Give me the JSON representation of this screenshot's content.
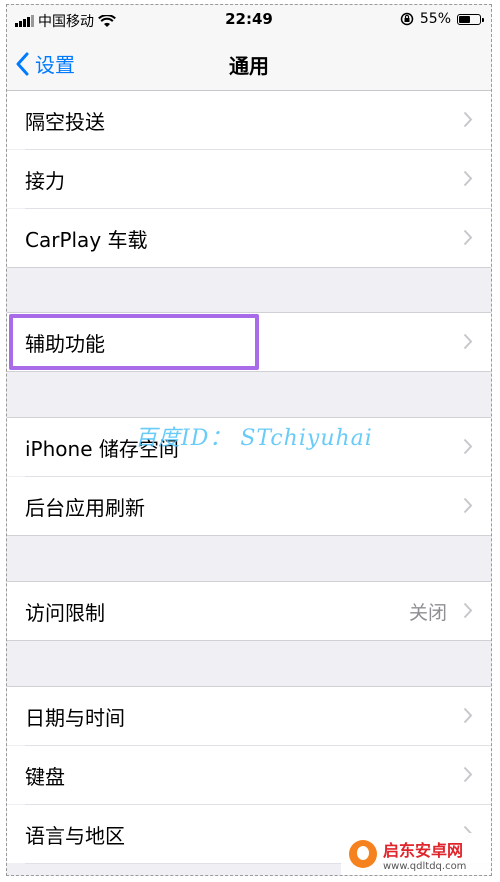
{
  "status_bar": {
    "carrier": "中国移动",
    "time": "22:49",
    "battery_percent": "55%",
    "battery_level": 0.55
  },
  "nav": {
    "back_label": "设置",
    "title": "通用"
  },
  "groups": [
    {
      "items": [
        {
          "label": "隔空投送"
        },
        {
          "label": "接力"
        },
        {
          "label": "CarPlay 车载"
        }
      ]
    },
    {
      "items": [
        {
          "label": "辅助功能"
        }
      ]
    },
    {
      "items": [
        {
          "label": "iPhone 储存空间"
        },
        {
          "label": "后台应用刷新"
        }
      ]
    },
    {
      "items": [
        {
          "label": "访问限制",
          "value": "关闭"
        }
      ]
    },
    {
      "items": [
        {
          "label": "日期与时间"
        },
        {
          "label": "键盘"
        },
        {
          "label": "语言与地区"
        }
      ]
    }
  ],
  "watermark": "百度ID： STchiyuhai",
  "corner_logo": {
    "title": "启东安卓网",
    "url": "www.qdltdq.com"
  },
  "colors": {
    "accent": "#007aff",
    "highlight": "#a86ce8",
    "watermark": "#4fc3f7"
  }
}
